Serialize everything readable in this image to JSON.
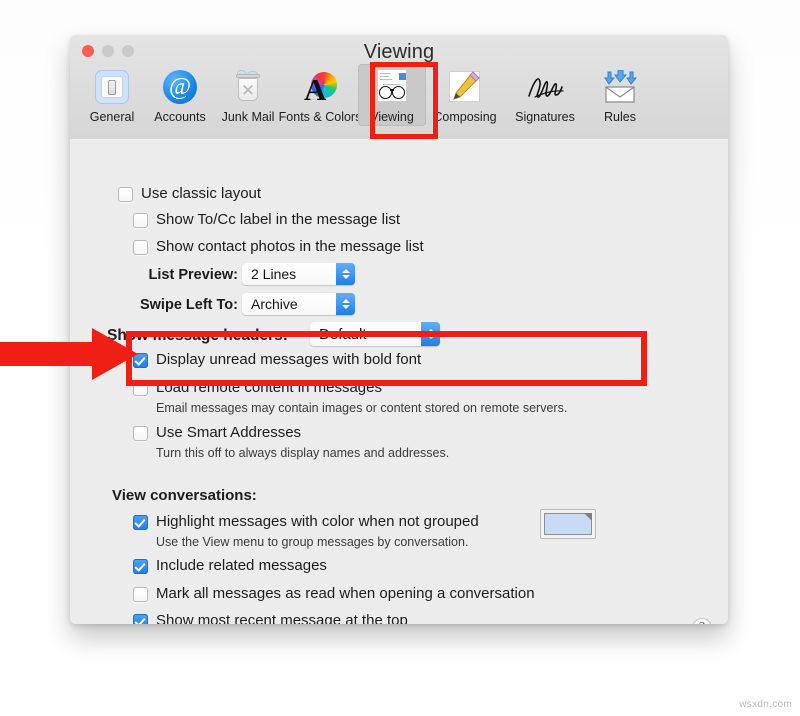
{
  "window": {
    "title": "Viewing",
    "traffic_lights": [
      "close",
      "minimize",
      "zoom"
    ]
  },
  "toolbar": {
    "items": [
      {
        "label": "General",
        "icon": "general-icon",
        "selected": false
      },
      {
        "label": "Accounts",
        "icon": "at-sign-icon",
        "selected": false
      },
      {
        "label": "Junk Mail",
        "icon": "trash-can-icon",
        "selected": false
      },
      {
        "label": "Fonts & Colors",
        "icon": "color-wheel-icon",
        "selected": false
      },
      {
        "label": "Viewing",
        "icon": "glasses-icon",
        "selected": true
      },
      {
        "label": "Composing",
        "icon": "pencil-icon",
        "selected": false
      },
      {
        "label": "Signatures",
        "icon": "signature-icon",
        "selected": false
      },
      {
        "label": "Rules",
        "icon": "envelope-arrows-icon",
        "selected": false
      }
    ]
  },
  "settings": {
    "use_classic_layout": {
      "label": "Use classic layout",
      "checked": false
    },
    "show_to_cc": {
      "label": "Show To/Cc label in the message list",
      "checked": false
    },
    "show_contact_photos": {
      "label": "Show contact photos in the message list",
      "checked": false
    },
    "list_preview": {
      "label": "List Preview:",
      "value": "2 Lines"
    },
    "swipe_left_to": {
      "label": "Swipe Left To:",
      "value": "Archive"
    },
    "show_message_headers": {
      "label": "Show message headers:",
      "value": "Default"
    },
    "display_unread_bold": {
      "label": "Display unread messages with bold font",
      "checked": true
    },
    "load_remote_content": {
      "label": "Load remote content in messages",
      "sublabel": "Email messages may contain images or content stored on remote servers.",
      "checked": false
    },
    "use_smart_addresses": {
      "label": "Use Smart Addresses",
      "sublabel": "Turn this off to always display names and addresses.",
      "checked": false
    }
  },
  "conversations": {
    "heading": "View conversations:",
    "highlight": {
      "label": "Highlight messages with color when not grouped",
      "sublabel": "Use the View menu to group messages by conversation.",
      "checked": true,
      "color": "#c8daf4"
    },
    "include_related": {
      "label": "Include related messages",
      "checked": true
    },
    "mark_all_read": {
      "label": "Mark all messages as read when opening a conversation",
      "checked": false
    },
    "show_most_recent": {
      "label": "Show most recent message at the top",
      "checked": true
    }
  },
  "help_button": {
    "label": "?"
  },
  "annotations": {
    "accent_color": "#f01f16",
    "highlight_toolbar_item": "Viewing",
    "highlight_setting": "Load remote content in messages",
    "arrow_points_to": "Load remote content in messages"
  },
  "watermark": {
    "text": "wsxdn.com"
  }
}
